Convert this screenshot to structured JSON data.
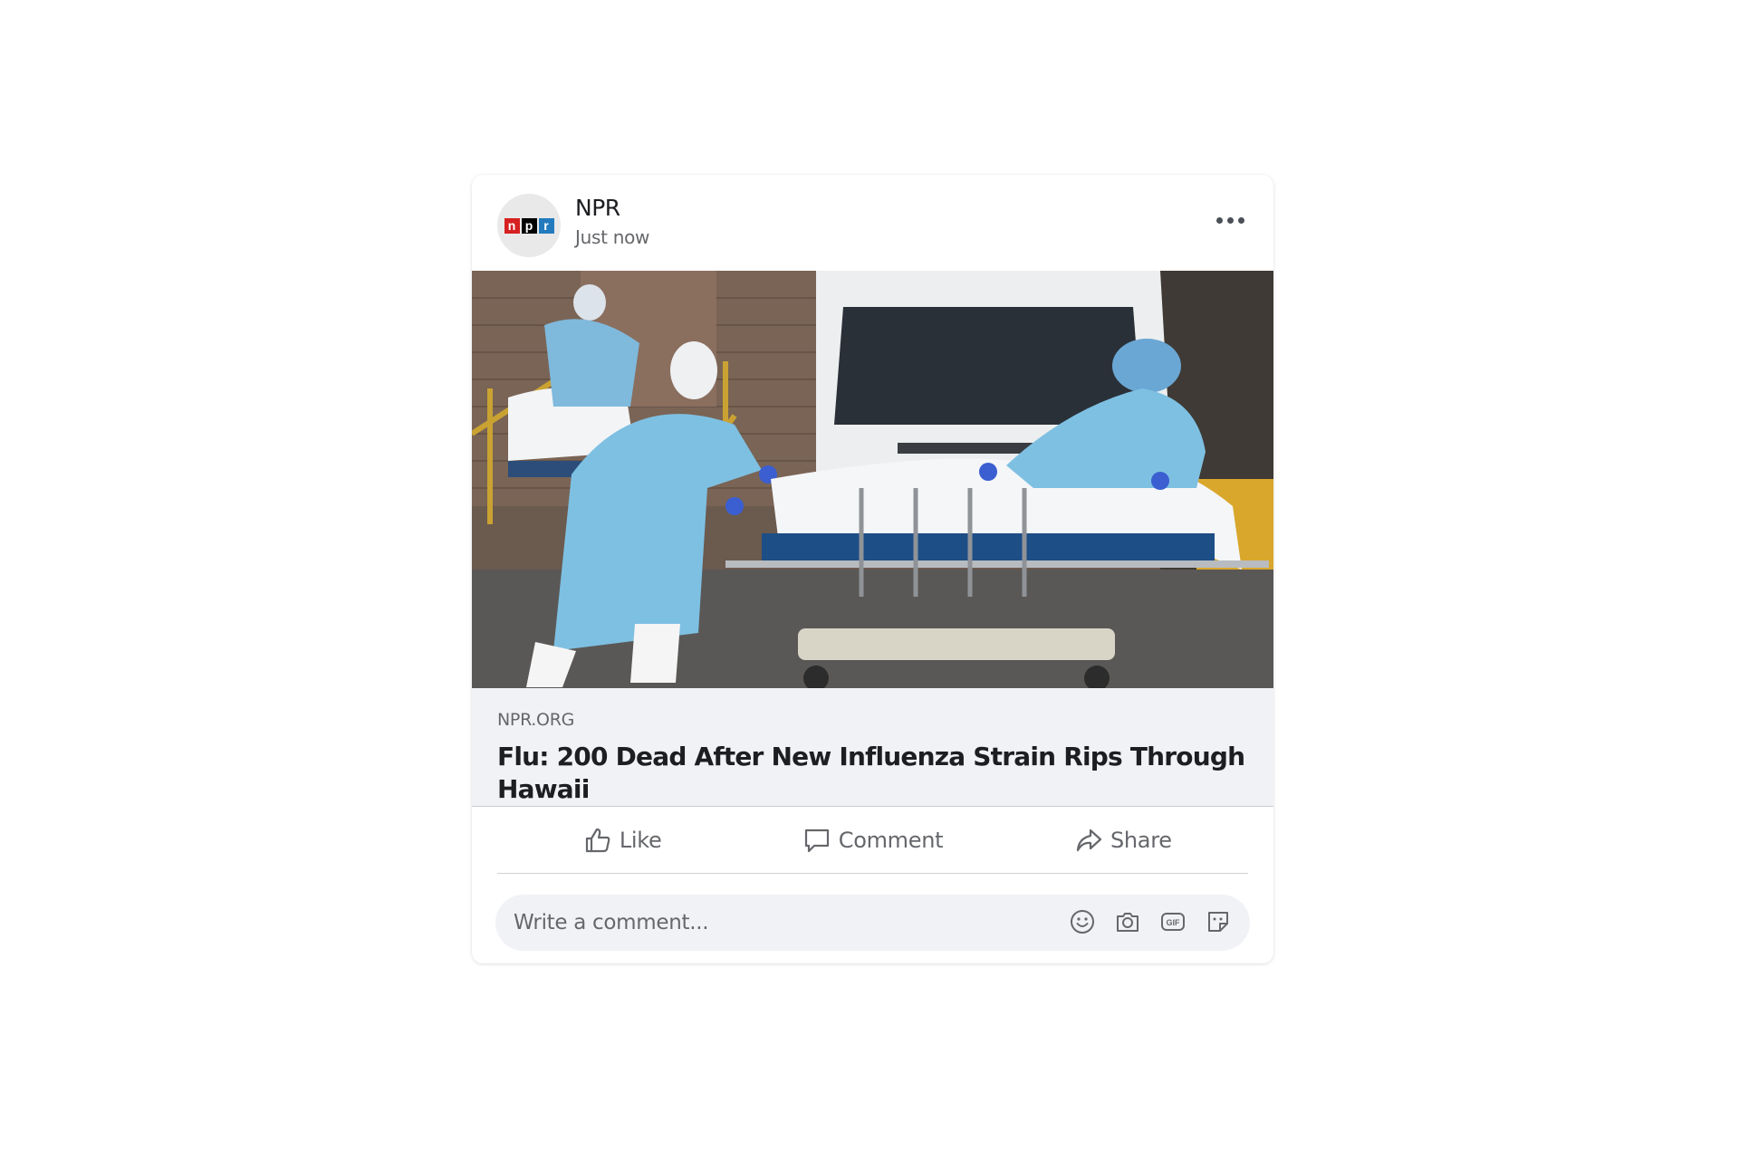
{
  "post": {
    "page_name": "NPR",
    "timestamp": "Just now",
    "avatar_logo": {
      "n": "n",
      "p": "p",
      "r": "r"
    },
    "more_icon": "more-horizontal-icon"
  },
  "link": {
    "domain": "NPR.ORG",
    "title": "Flu: 200 Dead After New Influenza Strain Rips Through Hawaii"
  },
  "actions": {
    "like_label": "Like",
    "comment_label": "Comment",
    "share_label": "Share"
  },
  "comment": {
    "placeholder": "Write a comment...",
    "tools": [
      "emoji-icon",
      "camera-icon",
      "gif-icon",
      "sticker-icon"
    ]
  },
  "colors": {
    "npr_red": "#d62021",
    "npr_black": "#000000",
    "npr_blue": "#237bbd",
    "muted_text": "#65676b",
    "preview_bg": "#f0f2f5"
  }
}
